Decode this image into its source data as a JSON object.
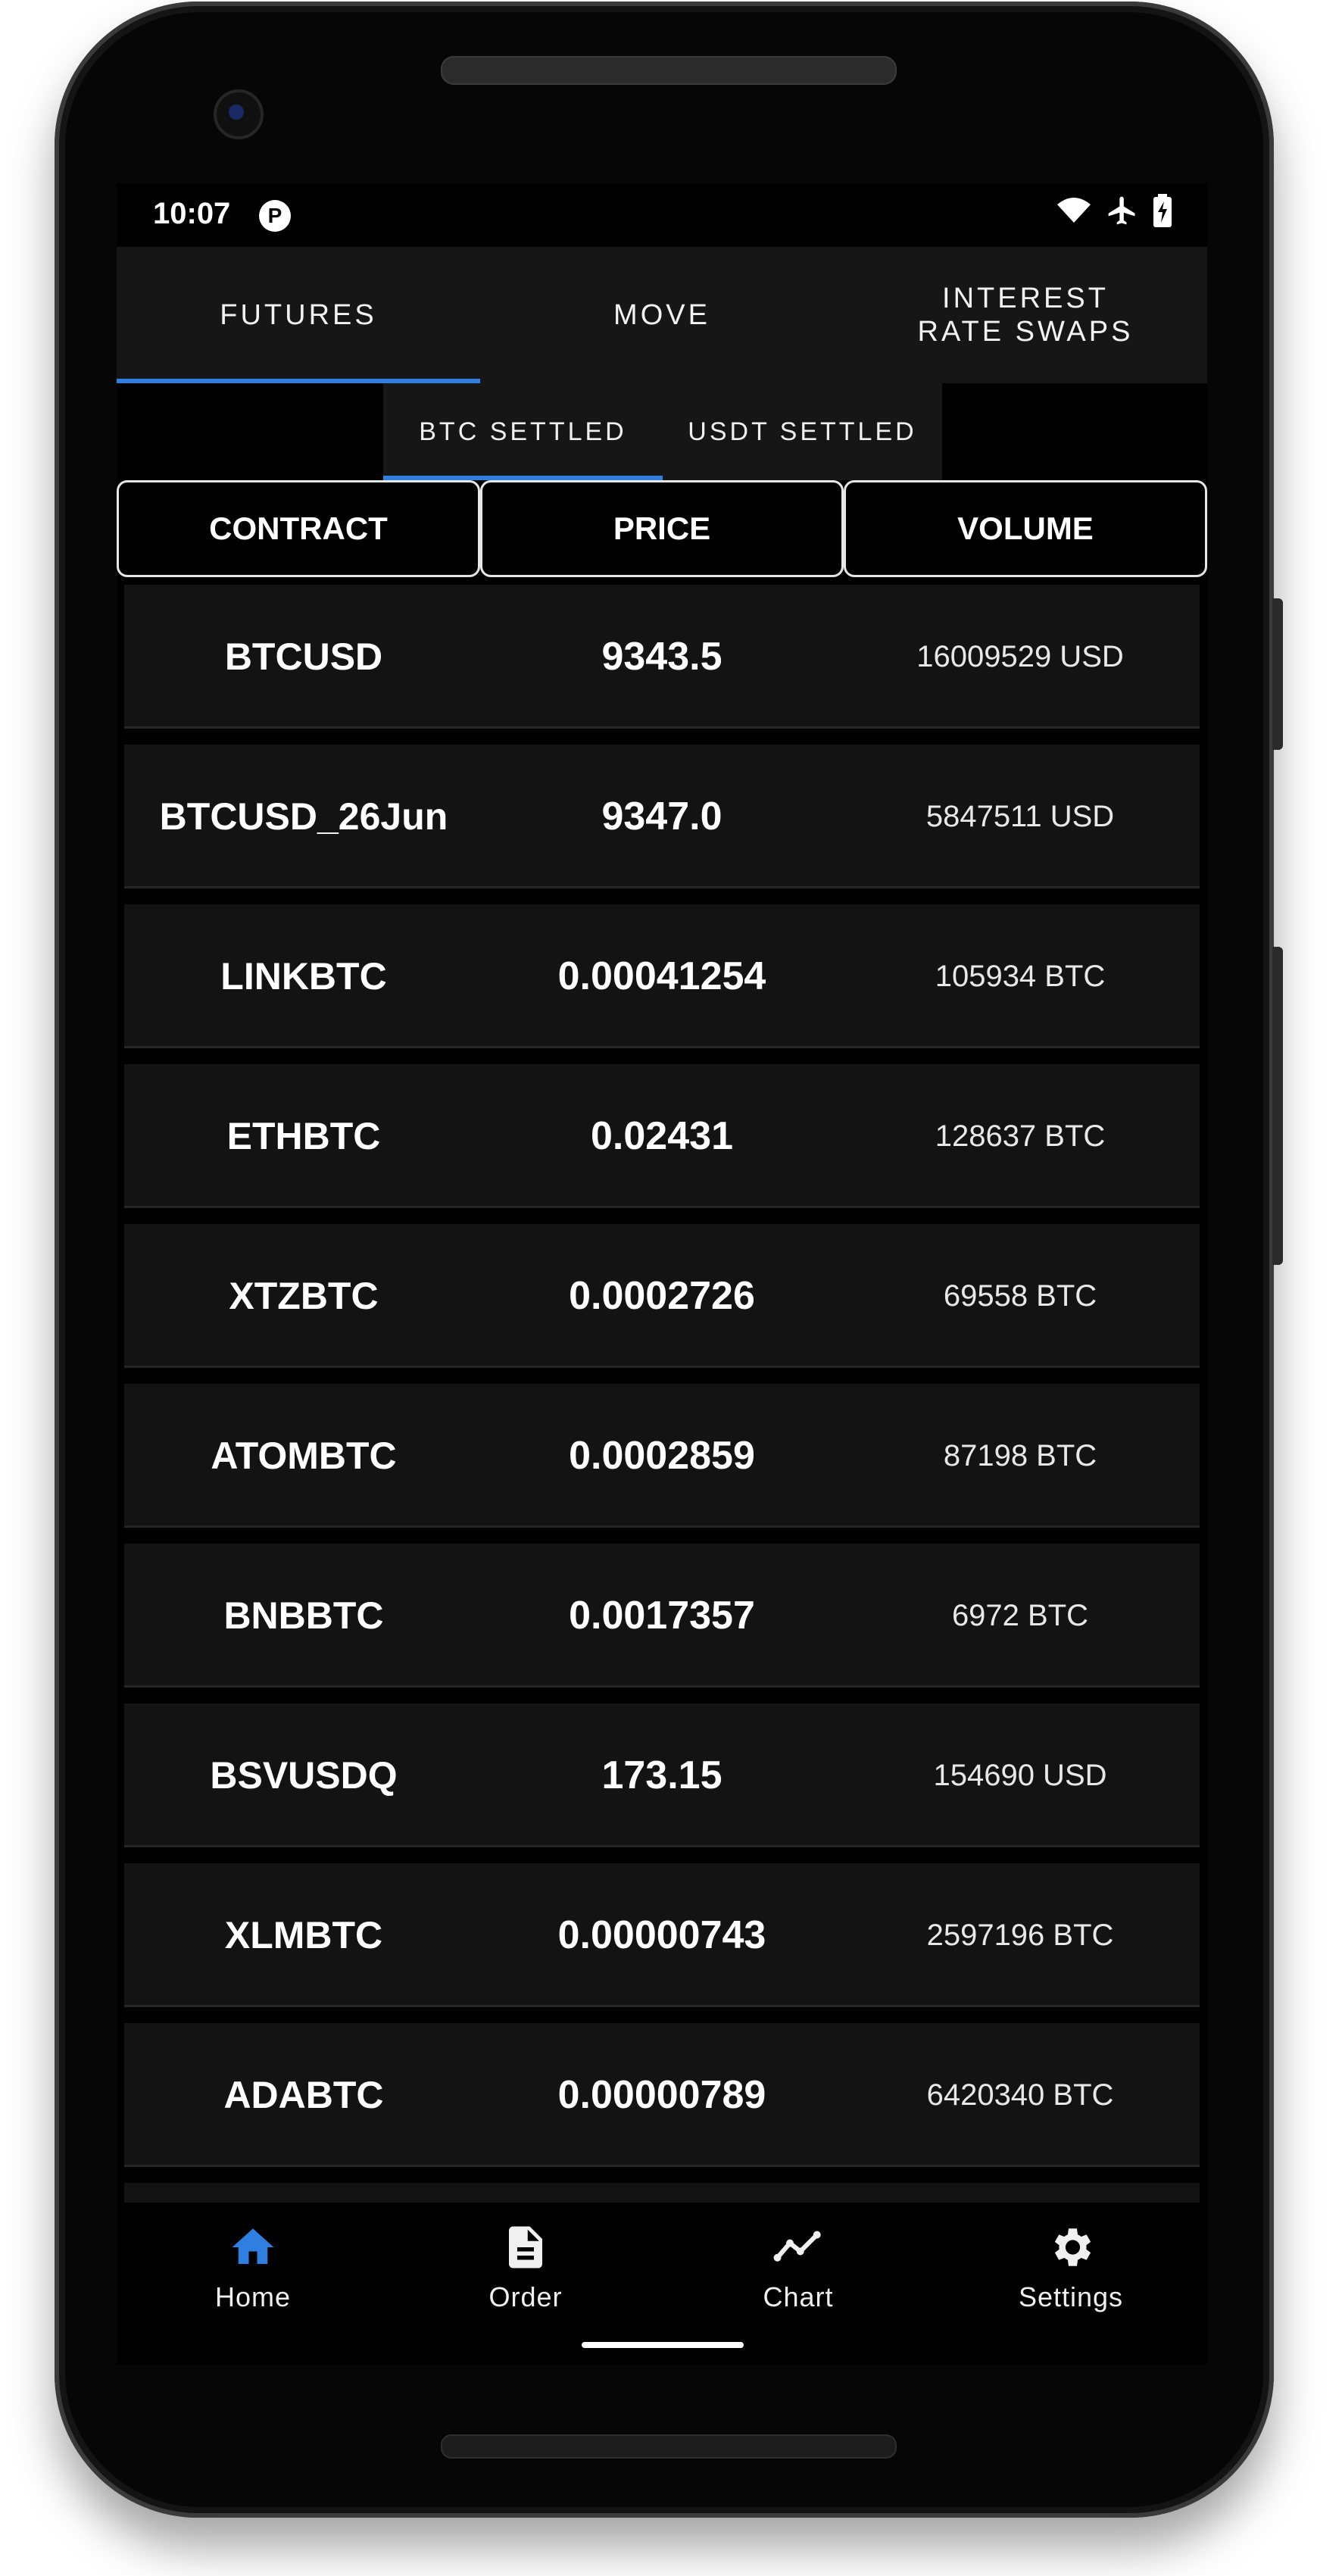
{
  "status_bar": {
    "time": "10:07",
    "app_icon_glyph": "P",
    "icons": [
      "wifi-icon",
      "airplane-icon",
      "battery-icon"
    ]
  },
  "top_tabs": [
    {
      "label": "FUTURES",
      "active": true
    },
    {
      "label": "MOVE",
      "active": false
    },
    {
      "label": "INTEREST RATE SWAPS",
      "active": false
    }
  ],
  "sub_tabs": [
    {
      "label": "BTC SETTLED",
      "active": true
    },
    {
      "label": "USDT SETTLED",
      "active": false
    }
  ],
  "table": {
    "headers": [
      "CONTRACT",
      "PRICE",
      "VOLUME"
    ],
    "rows": [
      {
        "contract": "BTCUSD",
        "price": "9343.5",
        "volume": "16009529 USD"
      },
      {
        "contract": "BTCUSD_26Jun",
        "price": "9347.0",
        "volume": "5847511 USD"
      },
      {
        "contract": "LINKBTC",
        "price": "0.00041254",
        "volume": "105934 BTC"
      },
      {
        "contract": "ETHBTC",
        "price": "0.02431",
        "volume": "128637 BTC"
      },
      {
        "contract": "XTZBTC",
        "price": "0.0002726",
        "volume": "69558 BTC"
      },
      {
        "contract": "ATOMBTC",
        "price": "0.0002859",
        "volume": "87198 BTC"
      },
      {
        "contract": "BNBBTC",
        "price": "0.0017357",
        "volume": "6972 BTC"
      },
      {
        "contract": "BSVUSDQ",
        "price": "173.15",
        "volume": "154690 USD"
      },
      {
        "contract": "XLMBTC",
        "price": "0.00000743",
        "volume": "2597196 BTC"
      },
      {
        "contract": "ADABTC",
        "price": "0.00000789",
        "volume": "6420340 BTC"
      }
    ]
  },
  "bottom_nav": [
    {
      "label": "Home",
      "icon": "home-icon",
      "active": true
    },
    {
      "label": "Order",
      "icon": "document-icon",
      "active": false
    },
    {
      "label": "Chart",
      "icon": "chart-line-icon",
      "active": false
    },
    {
      "label": "Settings",
      "icon": "gear-icon",
      "active": false
    }
  ],
  "colors": {
    "accent": "#2f7fe0",
    "background": "#000000",
    "row_background": "#131313",
    "tab_background": "#161616",
    "text": "#ffffff"
  }
}
